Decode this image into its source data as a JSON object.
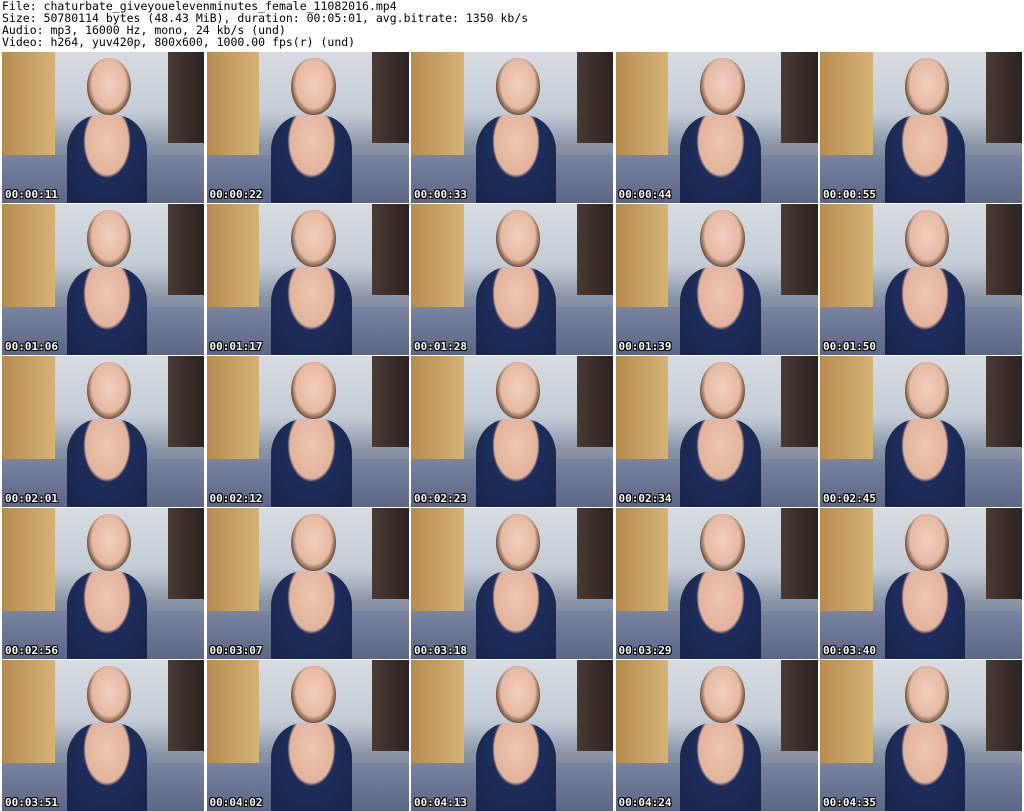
{
  "header": {
    "file": "File: chaturbate_giveyouelevenminutes_female_11082016.mp4",
    "size": "Size: 50780114 bytes (48.43 MiB), duration: 00:05:01, avg.bitrate: 1350 kb/s",
    "audio": "Audio: mp3, 16000 Hz, mono, 24 kb/s (und)",
    "video": "Video: h264, yuv420p, 800x600, 1000.00 fps(r) (und)"
  },
  "thumbnails": [
    "00:00:11",
    "00:00:22",
    "00:00:33",
    "00:00:44",
    "00:00:55",
    "00:01:06",
    "00:01:17",
    "00:01:28",
    "00:01:39",
    "00:01:50",
    "00:02:01",
    "00:02:12",
    "00:02:23",
    "00:02:34",
    "00:02:45",
    "00:02:56",
    "00:03:07",
    "00:03:18",
    "00:03:29",
    "00:03:40",
    "00:03:51",
    "00:04:02",
    "00:04:13",
    "00:04:24",
    "00:04:35"
  ]
}
